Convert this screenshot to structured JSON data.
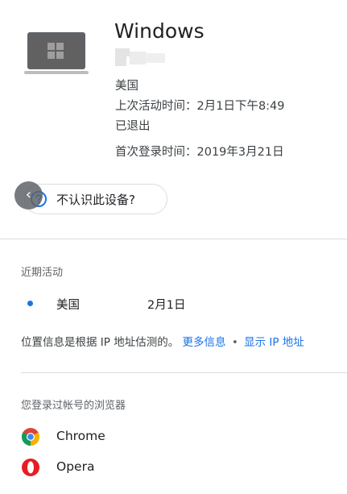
{
  "device": {
    "name": "Windows",
    "location": "美国",
    "last_activity": "上次活动时间：2月1日下午8:49",
    "status": "已退出",
    "first_signin": "首次登录时间：2019年3月21日",
    "unrecognized_label": "不认识此设备?"
  },
  "recent_activity": {
    "title": "近期活动",
    "items": [
      {
        "location": "美国",
        "date": "2月1日"
      }
    ],
    "note": "位置信息是根据 IP 地址估测的。",
    "more_info_link": "更多信息",
    "separator": "•",
    "show_ip_link": "显示 IP 地址"
  },
  "browsers": {
    "title": "您登录过帐号的浏览器",
    "items": [
      {
        "name": "Chrome",
        "icon": "chrome-icon"
      },
      {
        "name": "Opera",
        "icon": "opera-icon"
      }
    ]
  },
  "colors": {
    "accent": "#1a73e8",
    "divider": "#dadce0",
    "text_primary": "#202124",
    "text_secondary": "#5f6368"
  }
}
